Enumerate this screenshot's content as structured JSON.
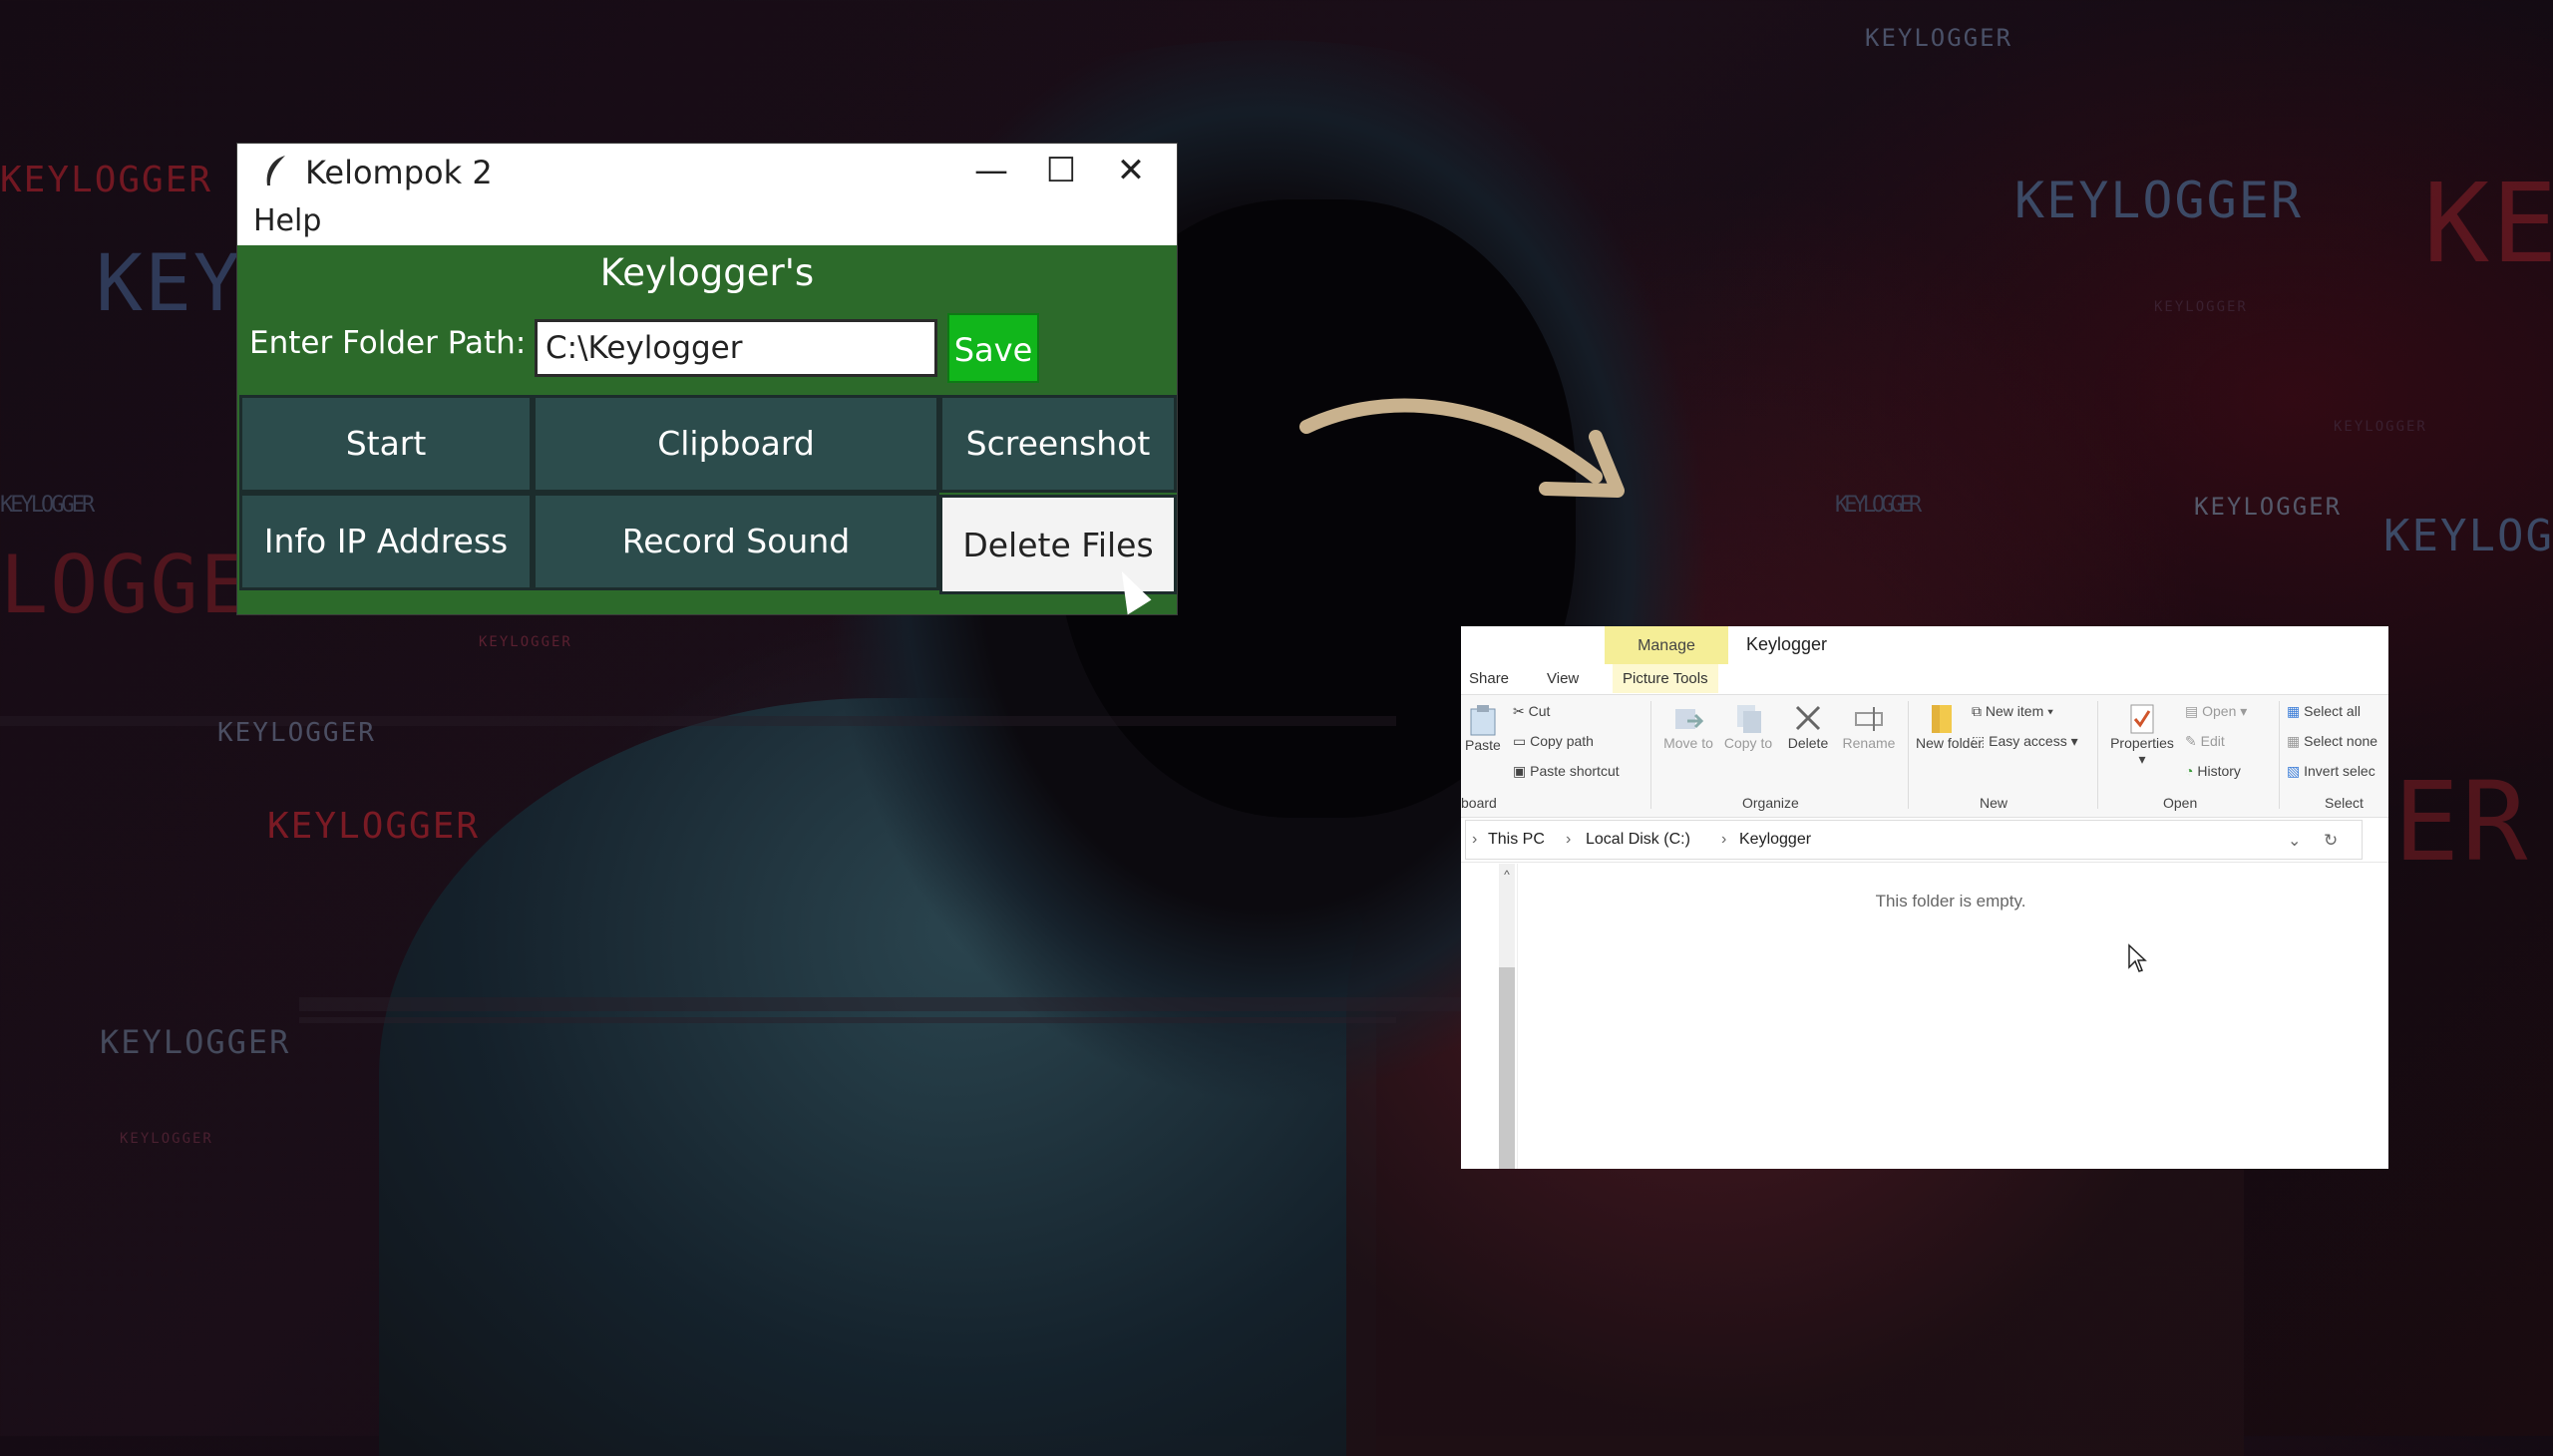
{
  "background": {
    "words": [
      "KEYLOGGER",
      "KEYLOGGER",
      "KEYLOGGER",
      "KEYLOGGER",
      "KEYLOGGER",
      "KEYLOGGER",
      "KEYLOGGER",
      "KEYLOGGER",
      "KEYLOGGER",
      "KEYLOGGER",
      "KEYLOGGER",
      "KEYLOGGER",
      "KEYLOGGER",
      "KEYLOGGER",
      "KE",
      "KEY",
      "KEYLOG",
      "LOGGE",
      "ER"
    ],
    "accent_red": "#b01e2a",
    "accent_slate": "#3c4a66"
  },
  "tk_window": {
    "title": "Kelompok 2",
    "controls": {
      "minimize": "—",
      "maximize": "☐",
      "close": "✕"
    },
    "menu": [
      "Help"
    ],
    "heading": "Keylogger's",
    "path_label": "Enter Folder Path:",
    "path_value": "C:\\Keylogger",
    "save_label": "Save",
    "buttons": [
      "Start",
      "Clipboard",
      "Screenshot",
      "Info IP Address",
      "Record Sound",
      "Delete Files"
    ],
    "colors": {
      "body": "#2c6a2a",
      "button": "#2c4c4c",
      "save": "#11b61b"
    }
  },
  "explorer": {
    "manage_tab": "Manage",
    "window_title": "Keylogger",
    "tabs": [
      "Share",
      "View",
      "Picture Tools"
    ],
    "ribbon": {
      "clipboard": {
        "paste": "Paste",
        "cut": "Cut",
        "copy_path": "Copy path",
        "paste_shortcut": "Paste shortcut",
        "section": "board"
      },
      "organize": {
        "move_to": "Move to",
        "copy_to": "Copy to",
        "delete": "Delete",
        "rename": "Rename",
        "section": "Organize"
      },
      "new": {
        "new_folder": "New folder",
        "new_item": "New item",
        "easy_access": "Easy access",
        "section": "New"
      },
      "open": {
        "properties": "Properties",
        "open": "Open",
        "edit": "Edit",
        "history": "History",
        "section": "Open"
      },
      "select": {
        "select_all": "Select all",
        "select_none": "Select none",
        "invert": "Invert selec",
        "section": "Select"
      }
    },
    "breadcrumb": [
      "This PC",
      "Local Disk (C:)",
      "Keylogger"
    ],
    "empty_message": "This folder is empty."
  }
}
